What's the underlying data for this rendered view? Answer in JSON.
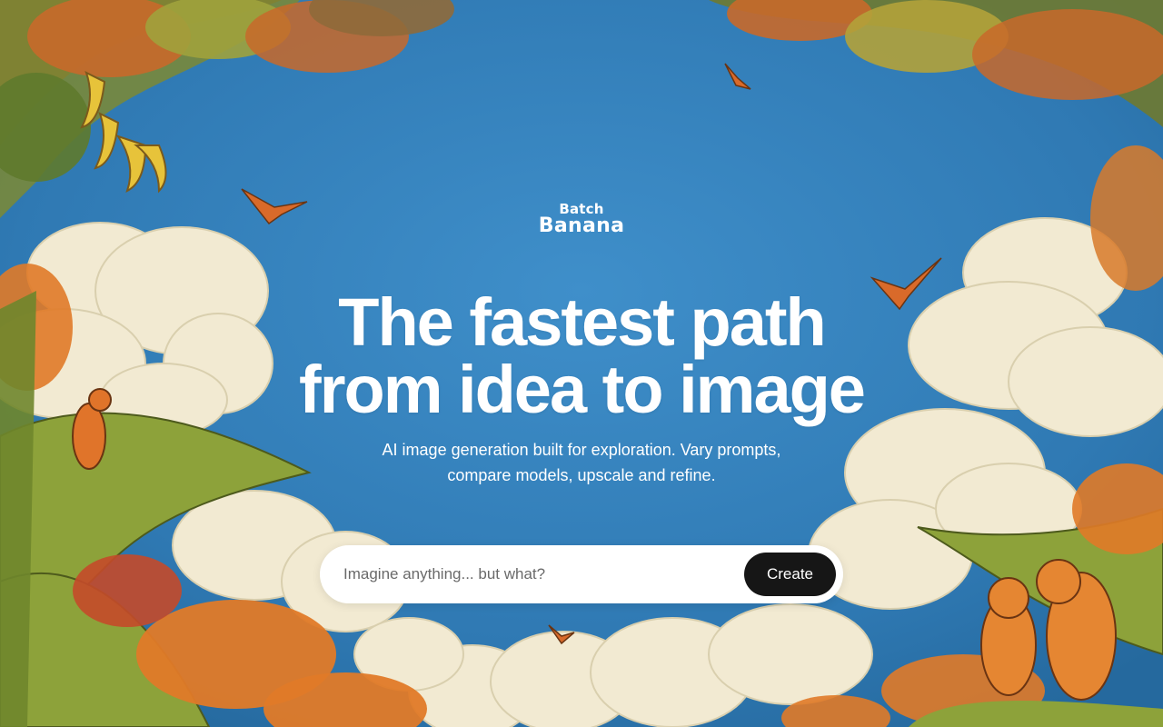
{
  "brand": {
    "line1": "Batch",
    "line2": "Banana"
  },
  "hero": {
    "headline_line1": "The fastest path",
    "headline_line2": "from idea to image",
    "subtitle_line1": "AI image generation built for exploration. Vary prompts,",
    "subtitle_line2": "compare models, upscale and refine."
  },
  "prompt": {
    "placeholder": "Imagine anything... but what?",
    "value": "",
    "submit_label": "Create"
  },
  "colors": {
    "sky": "#3b86bf",
    "cloud": "#f3ecd6",
    "foliage_green": "#7f9a3a",
    "foliage_orange": "#e07a28",
    "button": "#161616",
    "text": "#ffffff"
  }
}
